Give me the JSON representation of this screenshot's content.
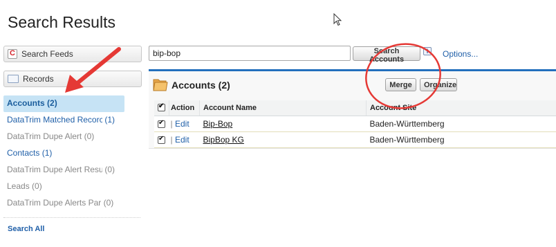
{
  "page": {
    "title": "Search Results"
  },
  "sidebar": {
    "search_feeds_label": "Search Feeds",
    "records_label": "Records",
    "items": [
      {
        "name": "Accounts",
        "count": "(2)"
      },
      {
        "name": "DataTrim Matched Recorc",
        "count": "(1)"
      },
      {
        "name": "DataTrim Dupe Alert",
        "count": "(0)"
      },
      {
        "name": "Contacts",
        "count": "(1)"
      },
      {
        "name": "DataTrim Dupe Alert Resu",
        "count": "(0)"
      },
      {
        "name": "Leads",
        "count": "(0)"
      },
      {
        "name": "DataTrim Dupe Alerts Par",
        "count": "(0)"
      }
    ],
    "search_all_label": "Search All"
  },
  "search": {
    "value": "bip-bop",
    "button_label": "Search Accounts",
    "info_icon": "i",
    "options_label": "Options..."
  },
  "panel": {
    "title": "Accounts (2)",
    "merge_label": "Merge",
    "organize_label": "Organize",
    "columns": [
      "Action",
      "Account Name",
      "Account Site"
    ],
    "rows": [
      {
        "edit": "Edit",
        "name": "Bip-Bop",
        "site": "Baden-Württemberg"
      },
      {
        "edit": "Edit",
        "name": "BipBop KG",
        "site": "Baden-Württemberg"
      }
    ]
  },
  "colors": {
    "accent": "#236fbd",
    "annotation": "#e53935",
    "active_bg": "#c6e3f5"
  },
  "icons": {
    "feeds": "chatter-feed-icon",
    "records": "folder-icon",
    "accounts": "accounts-folder-icon",
    "cursor": "mouse-pointer-icon"
  }
}
